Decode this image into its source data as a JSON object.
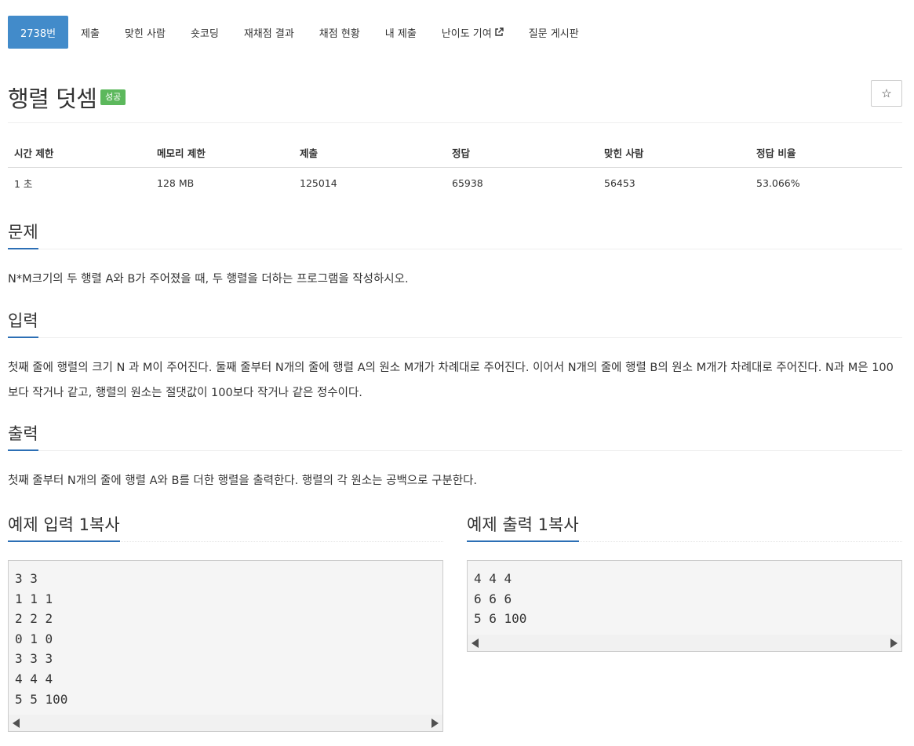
{
  "tabs": [
    {
      "label": "2738번",
      "active": true
    },
    {
      "label": "제출"
    },
    {
      "label": "맞힌 사람"
    },
    {
      "label": "숏코딩"
    },
    {
      "label": "재채점 결과"
    },
    {
      "label": "채점 현황"
    },
    {
      "label": "내 제출"
    },
    {
      "label": "난이도 기여",
      "icon": "external-link-icon"
    },
    {
      "label": "질문 게시판"
    }
  ],
  "problem": {
    "title": "행렬 덧셈",
    "badge": "성공",
    "badge_color": "#5cb85c",
    "star_icon": "☆"
  },
  "info": {
    "headers": [
      "시간 제한",
      "메모리 제한",
      "제출",
      "정답",
      "맞힌 사람",
      "정답 비율"
    ],
    "values": [
      "1 초",
      "128 MB",
      "125014",
      "65938",
      "56453",
      "53.066%"
    ]
  },
  "sections": {
    "problem": {
      "title": "문제",
      "text": "N*M크기의 두 행렬 A와 B가 주어졌을 때, 두 행렬을 더하는 프로그램을 작성하시오."
    },
    "input": {
      "title": "입력",
      "text": "첫째 줄에 행렬의 크기 N 과 M이 주어진다. 둘째 줄부터 N개의 줄에 행렬 A의 원소 M개가 차례대로 주어진다. 이어서 N개의 줄에 행렬 B의 원소 M개가 차례대로 주어진다. N과 M은 100보다 작거나 같고, 행렬의 원소는 절댓값이 100보다 작거나 같은 정수이다."
    },
    "output": {
      "title": "출력",
      "text": "첫째 줄부터 N개의 줄에 행렬 A와 B를 더한 행렬을 출력한다. 행렬의 각 원소는 공백으로 구분한다."
    }
  },
  "samples": {
    "copy_label": "복사",
    "input": {
      "title": "예제 입력 1",
      "content": "3 3\n1 1 1\n2 2 2\n0 1 0\n3 3 3\n4 4 4\n5 5 100"
    },
    "output": {
      "title": "예제 출력 1",
      "content": "4 4 4\n6 6 6\n5 6 100"
    }
  },
  "colors": {
    "accent": "#428bca",
    "section_underline": "#2c6fb5",
    "success": "#5cb85c"
  }
}
